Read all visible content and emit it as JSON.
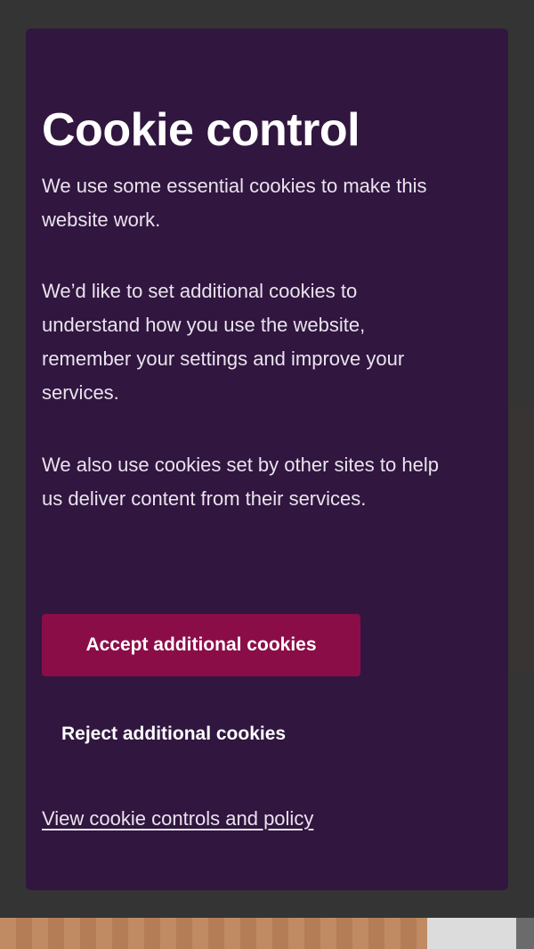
{
  "cookie_banner": {
    "title": "Cookie control",
    "paragraphs": [
      "We use some essential cookies to make this website work.",
      "We’d like to set additional cookies to understand how you use the website, remember your settings and improve your services.",
      "We also use cookies set by other sites to help us deliver content from their services."
    ],
    "accept_label": "Accept additional cookies",
    "reject_label": "Reject additional cookies",
    "policy_link_label": "View cookie controls and policy"
  },
  "colors": {
    "modal_background": "#31163f",
    "accept_button": "#8b0d48",
    "text": "#ffffff",
    "scrim": "#3a3a3a"
  }
}
